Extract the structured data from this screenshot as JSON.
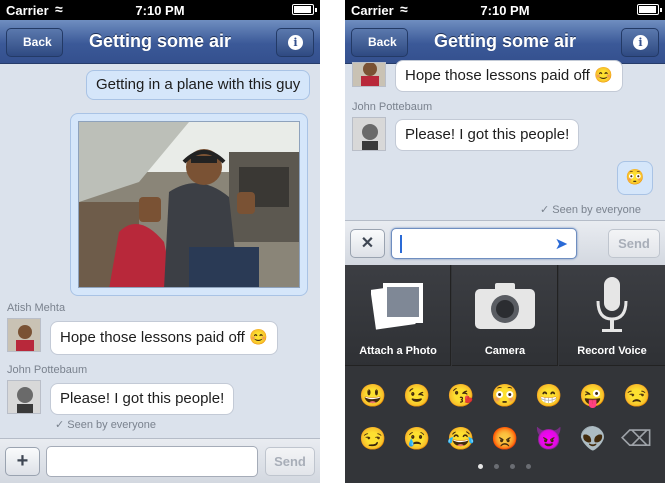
{
  "status_bar": {
    "carrier": "Carrier",
    "time": "7:10 PM"
  },
  "nav": {
    "back_label": "Back",
    "title": "Getting some air",
    "info_icon": "i"
  },
  "left_screen": {
    "messages": {
      "outgoing_1": "Getting in a plane with this guy",
      "sender_1": "Atish Mehta",
      "incoming_1": "Hope those lessons paid off 😊",
      "sender_2": "John Pottebaum",
      "incoming_2": "Please! I got this people!",
      "seen": "✓ Seen by everyone"
    },
    "input": {
      "add_label": "+",
      "send_label": "Send",
      "placeholder": ""
    }
  },
  "right_screen": {
    "messages": {
      "incoming_1": "Hope those lessons paid off 😊",
      "sender_2": "John Pottebaum",
      "incoming_2": "Please! I got this people!",
      "outgoing_emoji": "😳",
      "seen": "✓ Seen by everyone"
    },
    "input": {
      "close_label": "✕",
      "send_label": "Send"
    },
    "attachments": [
      {
        "label": "Attach a Photo",
        "icon": "photos-icon"
      },
      {
        "label": "Camera",
        "icon": "camera-icon"
      },
      {
        "label": "Record Voice",
        "icon": "microphone-icon"
      }
    ],
    "emoji_row_1": [
      "😃",
      "😉",
      "😘",
      "😳",
      "😁",
      "😜",
      "😒"
    ],
    "emoji_row_2": [
      "😏",
      "😢",
      "😂",
      "😡",
      "😈",
      "👽"
    ],
    "backspace_icon": "⌫"
  },
  "colors": {
    "nav_blue": "#3b5998",
    "outgoing_bubble": "#d5e6fa",
    "keyboard_dark": "#333539"
  }
}
